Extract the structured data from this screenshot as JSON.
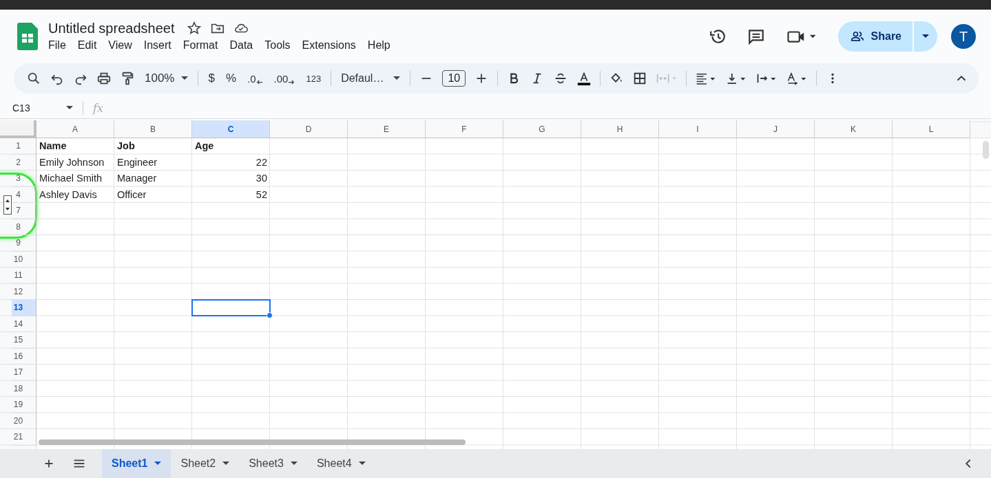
{
  "document": {
    "title": "Untitled spreadsheet"
  },
  "menu": [
    "File",
    "Edit",
    "View",
    "Insert",
    "Format",
    "Data",
    "Tools",
    "Extensions",
    "Help"
  ],
  "share": {
    "label": "Share"
  },
  "account": {
    "initial": "T"
  },
  "toolbar": {
    "zoom": "100%",
    "currency": "$",
    "percent": "%",
    "decrease_decimal": ".0",
    "increase_decimal": ".00",
    "number_format": "123",
    "font": "Defaul…",
    "font_size": "10"
  },
  "formula_bar": {
    "cell_ref": "C13",
    "fx": "fx"
  },
  "columns": [
    {
      "label": "A",
      "selected": false
    },
    {
      "label": "B",
      "selected": false
    },
    {
      "label": "C",
      "selected": true
    },
    {
      "label": "D",
      "selected": false
    },
    {
      "label": "E",
      "selected": false
    },
    {
      "label": "F",
      "selected": false
    },
    {
      "label": "G",
      "selected": false
    },
    {
      "label": "H",
      "selected": false
    },
    {
      "label": "I",
      "selected": false
    },
    {
      "label": "J",
      "selected": false
    },
    {
      "label": "K",
      "selected": false
    },
    {
      "label": "L",
      "selected": false
    }
  ],
  "rows": [
    {
      "label": "1",
      "selected": false,
      "bold": true,
      "hidden_after": false,
      "cells": [
        {
          "text": "Name",
          "kind": "text"
        },
        {
          "text": "Job",
          "kind": "text"
        },
        {
          "text": "Age",
          "kind": "text"
        }
      ]
    },
    {
      "label": "2",
      "selected": false,
      "bold": false,
      "hidden_after": false,
      "cells": [
        {
          "text": "Emily Johnson",
          "kind": "text"
        },
        {
          "text": "Engineer",
          "kind": "text"
        },
        {
          "text": "22",
          "kind": "number"
        }
      ]
    },
    {
      "label": "3",
      "selected": false,
      "bold": false,
      "hidden_after": false,
      "cells": [
        {
          "text": "Michael Smith",
          "kind": "text"
        },
        {
          "text": "Manager",
          "kind": "text"
        },
        {
          "text": "30",
          "kind": "number"
        }
      ]
    },
    {
      "label": "4",
      "selected": false,
      "bold": false,
      "hidden_after": true,
      "cells": [
        {
          "text": "Ashley Davis",
          "kind": "text"
        },
        {
          "text": "Officer",
          "kind": "text"
        },
        {
          "text": "52",
          "kind": "number"
        }
      ]
    },
    {
      "label": "7",
      "selected": false,
      "hidden_after": false,
      "cells": []
    },
    {
      "label": "8",
      "selected": false,
      "hidden_after": false,
      "cells": []
    },
    {
      "label": "9",
      "selected": false,
      "hidden_after": false,
      "cells": []
    },
    {
      "label": "10",
      "selected": false,
      "hidden_after": false,
      "cells": []
    },
    {
      "label": "11",
      "selected": false,
      "hidden_after": false,
      "cells": []
    },
    {
      "label": "12",
      "selected": false,
      "hidden_after": false,
      "cells": []
    },
    {
      "label": "13",
      "selected": true,
      "hidden_after": false,
      "cells": []
    },
    {
      "label": "14",
      "selected": false,
      "hidden_after": false,
      "cells": []
    },
    {
      "label": "15",
      "selected": false,
      "hidden_after": false,
      "cells": []
    },
    {
      "label": "16",
      "selected": false,
      "hidden_after": false,
      "cells": []
    },
    {
      "label": "17",
      "selected": false,
      "hidden_after": false,
      "cells": []
    },
    {
      "label": "18",
      "selected": false,
      "hidden_after": false,
      "cells": []
    },
    {
      "label": "19",
      "selected": false,
      "hidden_after": false,
      "cells": []
    },
    {
      "label": "20",
      "selected": false,
      "hidden_after": false,
      "cells": []
    },
    {
      "label": "21",
      "selected": false,
      "hidden_after": false,
      "cells": []
    }
  ],
  "sheets": [
    {
      "label": "Sheet1",
      "selected": true
    },
    {
      "label": "Sheet2",
      "selected": false
    },
    {
      "label": "Sheet3",
      "selected": false
    },
    {
      "label": "Sheet4",
      "selected": false
    }
  ]
}
